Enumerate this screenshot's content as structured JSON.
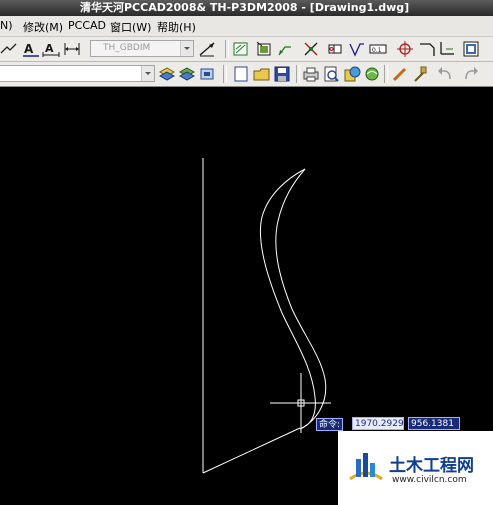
{
  "window": {
    "title": "清华天河PCCAD2008& TH-P3DM2008 - [Drawing1.dwg]"
  },
  "menu": {
    "items": [
      {
        "label": "N)"
      },
      {
        "label": "修改(M)"
      },
      {
        "label": "PCCAD"
      },
      {
        "label": "窗口(W)"
      },
      {
        "label": "帮助(H)"
      }
    ]
  },
  "toolbar": {
    "style_combo_value": "TH_GBDIM"
  },
  "cursor_tooltip": {
    "prompt_label": "命令:",
    "x_value": "1970.2929",
    "y_value": "956.1381"
  },
  "watermark": {
    "title": "土木工程网",
    "url": "www.civilcn.com"
  },
  "colors": {
    "canvas_background": "#000000",
    "drawing_stroke": "#ffffff",
    "tooltip_blue": "#1a2a7a"
  }
}
